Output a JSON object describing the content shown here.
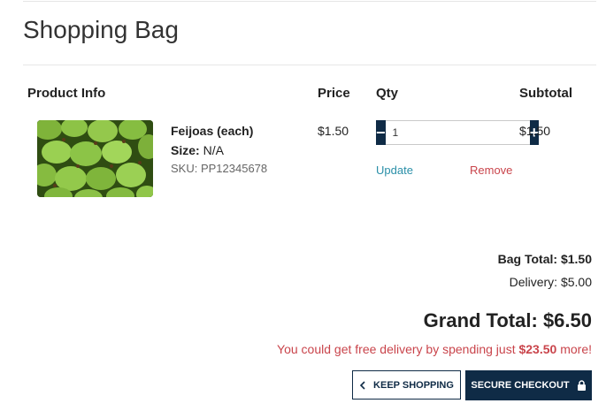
{
  "page": {
    "title": "Shopping Bag"
  },
  "table": {
    "headers": {
      "product": "Product Info",
      "price": "Price",
      "qty": "Qty",
      "subtotal": "Subtotal"
    }
  },
  "item": {
    "name": "Feijoas (each)",
    "size_label": "Size:",
    "size_value": "N/A",
    "sku": "SKU: PP12345678",
    "price": "$1.50",
    "quantity": "1",
    "subtotal": "$1.50",
    "update_label": "Update",
    "remove_label": "Remove",
    "decrement_symbol": "−",
    "increment_symbol": "+"
  },
  "totals": {
    "bag_label": "Bag Total:",
    "bag_value": "$1.50",
    "delivery_label": "Delivery:",
    "delivery_value": "$5.00",
    "grand_label": "Grand Total:",
    "grand_value": "$6.50",
    "promo_prefix": "You could get free delivery by spending just ",
    "promo_amount": "$23.50",
    "promo_suffix": " more!"
  },
  "actions": {
    "keep_shopping": "KEEP SHOPPING",
    "secure_checkout": "SECURE CHECKOUT"
  },
  "icons": {
    "keep_shopping": "chevron-left-icon",
    "secure_checkout": "lock-icon"
  },
  "colors": {
    "navy": "#0f2b46",
    "teal_link": "#2a8fa8",
    "red": "#c9444b"
  }
}
